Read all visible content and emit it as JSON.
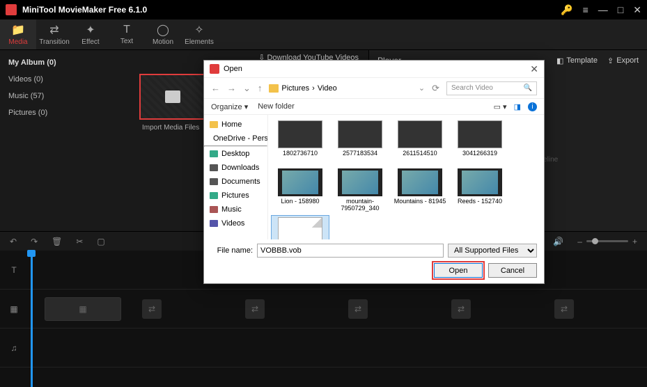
{
  "titlebar": {
    "title": "MiniTool MovieMaker Free 6.1.0"
  },
  "toolbar": [
    {
      "label": "Media",
      "icon": "📁",
      "active": true
    },
    {
      "label": "Transition",
      "icon": "⇄",
      "active": false
    },
    {
      "label": "Effect",
      "icon": "✦",
      "active": false
    },
    {
      "label": "Text",
      "icon": "T",
      "active": false
    },
    {
      "label": "Motion",
      "icon": "◯",
      "active": false
    },
    {
      "label": "Elements",
      "icon": "✧",
      "active": false
    }
  ],
  "sidebar": {
    "album": "My Album (0)",
    "items": [
      {
        "label": "Videos (0)"
      },
      {
        "label": "Music (57)"
      },
      {
        "label": "Pictures (0)"
      }
    ]
  },
  "media": {
    "download": "⇩ Download YouTube Videos",
    "import": "Import Media Files"
  },
  "player": {
    "title": "Player",
    "template": "Template",
    "export": "Export",
    "msg": "material selected on the timeline"
  },
  "dialog": {
    "title": "Open",
    "path": [
      "Pictures",
      "Video"
    ],
    "search_placeholder": "Search Video",
    "organize": "Organize ▾",
    "newfolder": "New folder",
    "nav": [
      {
        "label": "Home",
        "color": "#f3c24b"
      },
      {
        "label": "OneDrive - Pers",
        "color": "#0a72d8"
      },
      {
        "label": "Desktop",
        "color": "#3a8"
      },
      {
        "label": "Downloads",
        "color": "#555"
      },
      {
        "label": "Documents",
        "color": "#555"
      },
      {
        "label": "Pictures",
        "color": "#3a8"
      },
      {
        "label": "Music",
        "color": "#a55"
      },
      {
        "label": "Videos",
        "color": "#55a"
      }
    ],
    "files_num": [
      {
        "label": "1802736710"
      },
      {
        "label": "2577183534"
      },
      {
        "label": "2611514510"
      },
      {
        "label": "3041266319"
      }
    ],
    "files_img": [
      {
        "label": "Lion - 158980"
      },
      {
        "label": "mountain-7950729_340"
      },
      {
        "label": "Mountains - 81945"
      },
      {
        "label": "Reeds - 152740"
      }
    ],
    "file_sel": {
      "label": "VOBBB.vob"
    },
    "filename_label": "File name:",
    "filename_value": "VOBBB.vob",
    "filter": "All Supported Files",
    "open": "Open",
    "cancel": "Cancel"
  }
}
